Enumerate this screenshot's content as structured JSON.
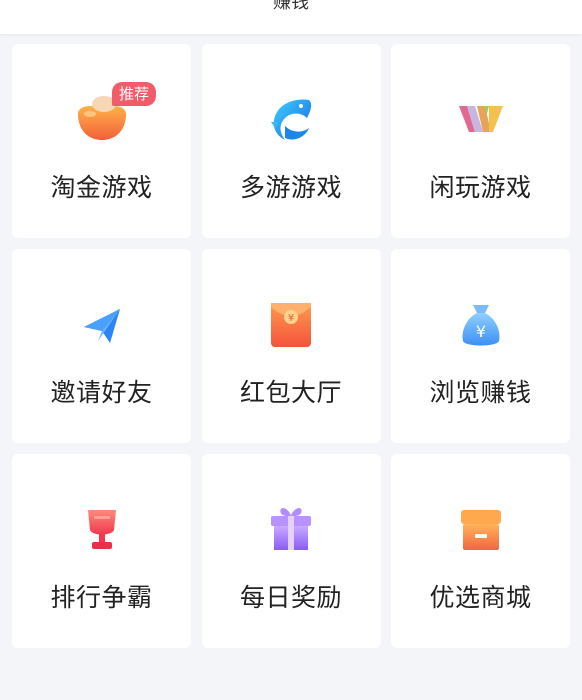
{
  "header": {
    "title": "赚钱"
  },
  "colors": {
    "background": "#f4f5f9",
    "card": "#ffffff",
    "badge": "#f35b6b",
    "text": "#222222"
  },
  "cards": [
    {
      "label": "淘金游戏",
      "icon": "gold-bean-icon",
      "badge": "推荐"
    },
    {
      "label": "多游游戏",
      "icon": "dolphin-icon"
    },
    {
      "label": "闲玩游戏",
      "icon": "w-logo-icon"
    },
    {
      "label": "邀请好友",
      "icon": "paper-plane-icon"
    },
    {
      "label": "红包大厅",
      "icon": "red-envelope-icon"
    },
    {
      "label": "浏览赚钱",
      "icon": "money-bag-icon"
    },
    {
      "label": "排行争霸",
      "icon": "trophy-icon"
    },
    {
      "label": "每日奖励",
      "icon": "gift-icon"
    },
    {
      "label": "优选商城",
      "icon": "store-box-icon"
    }
  ]
}
